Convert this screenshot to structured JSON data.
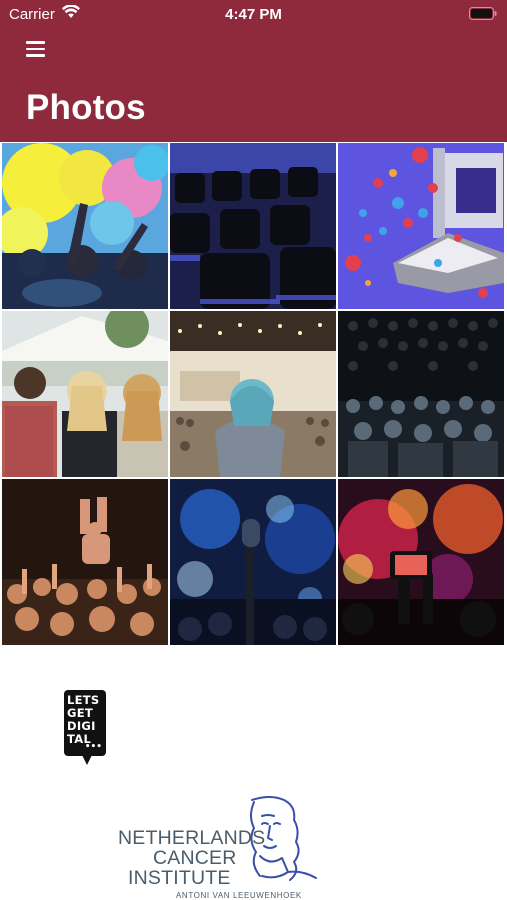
{
  "status_bar": {
    "carrier": "Carrier",
    "time": "4:47 PM"
  },
  "header": {
    "title": "Photos",
    "menu_icon": "hamburger-menu-icon"
  },
  "colors": {
    "header_bg": "#8e2a3b",
    "text_on_header": "#ffffff",
    "logo_text": "#4b5c6a"
  },
  "photos": [
    {
      "subject": "colorful-powder-festival-crowd"
    },
    {
      "subject": "empty-auditorium-seats"
    },
    {
      "subject": "social-media-reactions-illustration"
    },
    {
      "subject": "outdoor-festival-audience"
    },
    {
      "subject": "woman-in-conference-hall"
    },
    {
      "subject": "seated-audience-dark-hall"
    },
    {
      "subject": "concert-crowd-hands-up"
    },
    {
      "subject": "microphone-on-stage"
    },
    {
      "subject": "concert-phone-recording"
    }
  ],
  "logos": {
    "letsgetdigital": {
      "line1": "LETS",
      "line2": "GET",
      "line3": "DIGI",
      "line4": "TAL"
    },
    "nki": {
      "line1": "NETHERLANDS",
      "line2": "CANCER",
      "line3": "INSTITUTE",
      "subline": "ANTONI VAN LEEUWENHOEK"
    }
  }
}
